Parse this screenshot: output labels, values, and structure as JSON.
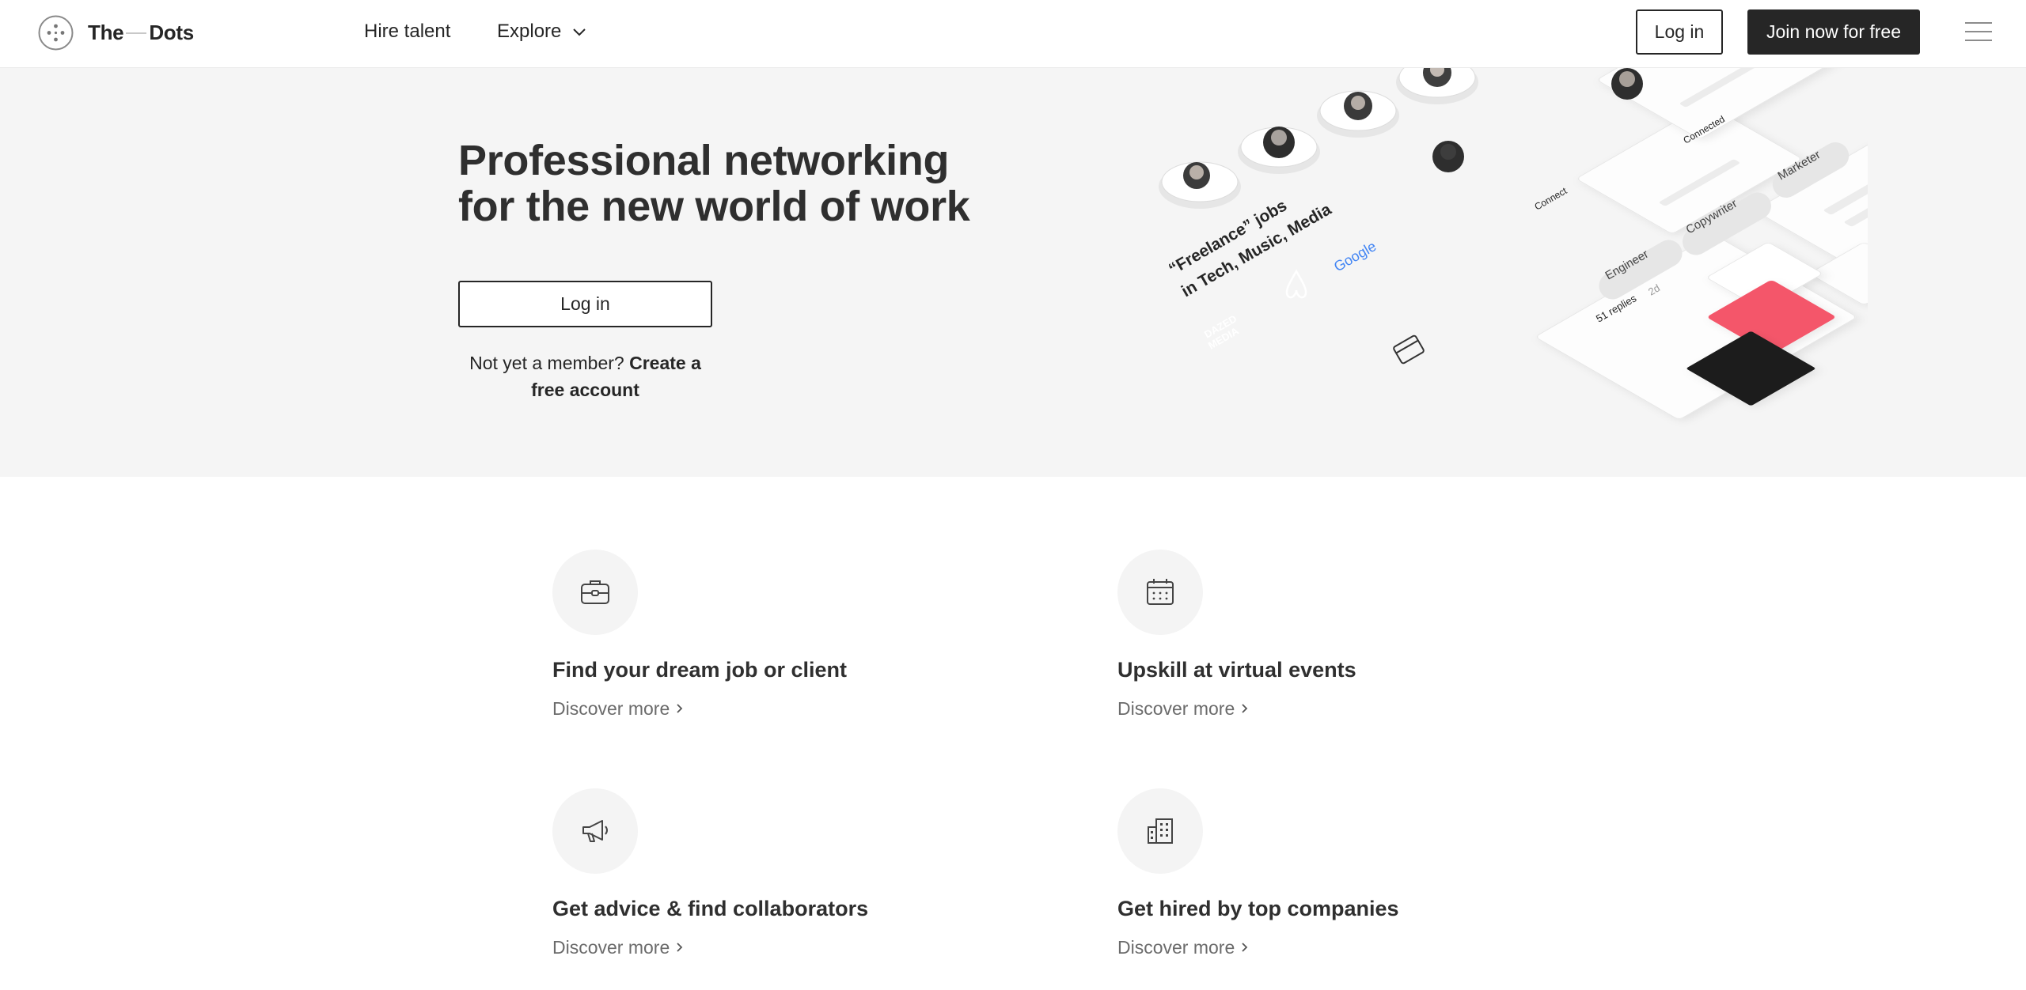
{
  "header": {
    "logo_text_left": "The",
    "logo_text_right": "Dots",
    "nav": {
      "hire_talent": "Hire talent",
      "explore": "Explore"
    },
    "login_label": "Log in",
    "join_label": "Join now for free"
  },
  "hero": {
    "title": "Professional networking for the new world of work",
    "login_label": "Log in",
    "member_prompt": "Not yet a member? ",
    "create_account": "Create a free account",
    "illustration": {
      "card_text_line1": "“Freelance” jobs",
      "card_text_line2": "in Tech, Music, Media",
      "google": "Google",
      "dazed_line1": "DAZED",
      "dazed_line2": "MEDIA",
      "connect": "Connect",
      "connected": "Connected",
      "tags": [
        "Engineer",
        "Copywriter",
        "Marketer"
      ],
      "replies": "51 replies",
      "replies_age": "2d"
    }
  },
  "features": [
    {
      "icon": "briefcase-icon",
      "title": "Find your dream job or client",
      "link": "Discover more"
    },
    {
      "icon": "calendar-icon",
      "title": "Upskill at virtual events",
      "link": "Discover more"
    },
    {
      "icon": "megaphone-icon",
      "title": "Get advice & find collaborators",
      "link": "Discover more"
    },
    {
      "icon": "building-icon",
      "title": "Get hired by top companies",
      "link": "Discover more"
    }
  ],
  "colors": {
    "dark": "#262626",
    "hero_bg": "#f5f5f5",
    "accent_airbnb": "#f4566a"
  }
}
